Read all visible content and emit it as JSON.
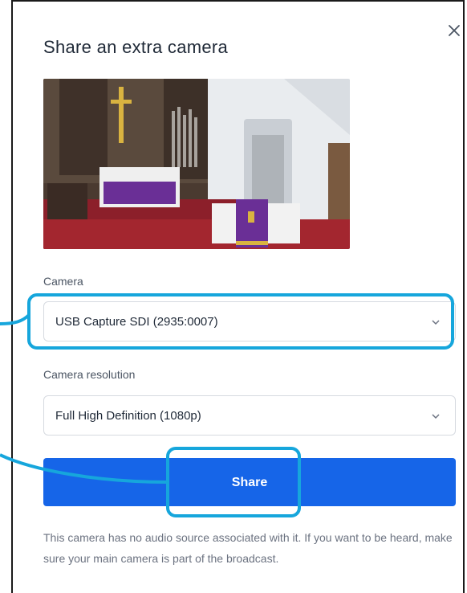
{
  "dialog": {
    "title": "Share an extra camera",
    "close_icon": "close-icon"
  },
  "camera": {
    "label": "Camera",
    "selected": "USB Capture SDI (2935:0007)"
  },
  "resolution": {
    "label": "Camera resolution",
    "selected": "Full High Definition (1080p)"
  },
  "share_button": {
    "label": "Share"
  },
  "note": "This camera has no audio source associated with it. If you want to be heard, make sure your main camera is part of the broadcast.",
  "colors": {
    "primary_button": "#1665e8",
    "highlight": "#16a6dc",
    "altar_cloth": "#6a2f96"
  },
  "icons": [
    "close-icon",
    "chevron-down-icon"
  ]
}
